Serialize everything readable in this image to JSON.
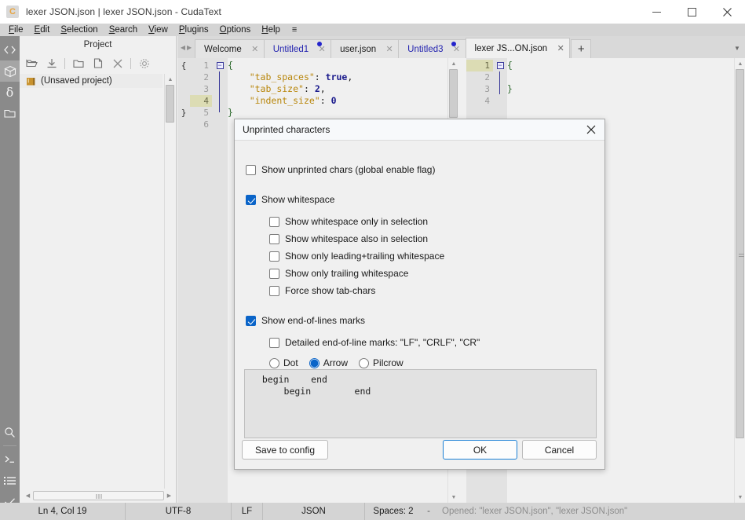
{
  "window": {
    "title": "lexer JSON.json | lexer JSON.json - CudaText",
    "app_icon": "C",
    "minimize_label": "minimize-icon",
    "maximize_label": "maximize-icon",
    "close_label": "close-icon"
  },
  "menubar": {
    "items": [
      {
        "label": "File",
        "accel": "F"
      },
      {
        "label": "Edit",
        "accel": "E"
      },
      {
        "label": "Selection",
        "accel": "S"
      },
      {
        "label": "Search",
        "accel": "S"
      },
      {
        "label": "View",
        "accel": "V"
      },
      {
        "label": "Plugins",
        "accel": "P"
      },
      {
        "label": "Options",
        "accel": "O"
      },
      {
        "label": "Help",
        "accel": "H"
      }
    ],
    "burger": "≡"
  },
  "rail": {
    "items": [
      {
        "name": "code-tree-icon",
        "glyph": "<>"
      },
      {
        "name": "project-box-icon",
        "glyph": "box"
      },
      {
        "name": "delta-icon",
        "glyph": "δ"
      },
      {
        "name": "folder-icon",
        "glyph": "folder"
      }
    ],
    "bottom_items": [
      {
        "name": "search-icon",
        "glyph": "search"
      },
      {
        "name": "console-icon",
        "glyph": ">_"
      },
      {
        "name": "output-list-icon",
        "glyph": "list"
      },
      {
        "name": "validate-check-icon",
        "glyph": "check"
      }
    ]
  },
  "project": {
    "title": "Project",
    "toolbar": [
      {
        "name": "open-project-button",
        "glyph": "open-folder-icon"
      },
      {
        "name": "save-project-button",
        "glyph": "download-icon"
      },
      {
        "name": "add-folder-button",
        "glyph": "folder-icon"
      },
      {
        "name": "add-file-button",
        "glyph": "file-icon"
      },
      {
        "name": "remove-node-button",
        "glyph": "close-icon"
      },
      {
        "name": "project-properties-button",
        "glyph": "gear-icon"
      }
    ],
    "root_node": "(Unsaved project)"
  },
  "tabs": [
    {
      "label": "Welcome",
      "active": false,
      "modified": false
    },
    {
      "label": "Untitled1",
      "active": false,
      "modified": true
    },
    {
      "label": "user.json",
      "active": false,
      "modified": false
    },
    {
      "label": "Untitled3",
      "active": false,
      "modified": true
    },
    {
      "label": "lexer JS...ON.json",
      "active": true,
      "modified": false
    }
  ],
  "tab_controls": {
    "add_tab": "+",
    "dropdown": "▼",
    "nav_left": "◀",
    "nav_right": "▶"
  },
  "editor_left": {
    "gutter_braces": [
      "{",
      "",
      "",
      "",
      "}",
      ""
    ],
    "line_numbers": [
      "1",
      "2",
      "3",
      "4",
      "5",
      "6"
    ],
    "current_line": 4,
    "lines": [
      {
        "segs": [
          {
            "t": "{",
            "c": "c-brace"
          }
        ]
      },
      {
        "segs": [
          {
            "t": "    ",
            "c": "c-punct"
          },
          {
            "t": "\"tab_spaces\"",
            "c": "c-key"
          },
          {
            "t": ": ",
            "c": "c-punct"
          },
          {
            "t": "true",
            "c": "c-bool"
          },
          {
            "t": ",",
            "c": "c-punct"
          }
        ]
      },
      {
        "segs": [
          {
            "t": "    ",
            "c": "c-punct"
          },
          {
            "t": "\"tab_size\"",
            "c": "c-key"
          },
          {
            "t": ": ",
            "c": "c-punct"
          },
          {
            "t": "2",
            "c": "c-num"
          },
          {
            "t": ",",
            "c": "c-punct"
          }
        ]
      },
      {
        "segs": [
          {
            "t": "    ",
            "c": "c-punct"
          },
          {
            "t": "\"indent_size\"",
            "c": "c-key"
          },
          {
            "t": ": ",
            "c": "c-punct"
          },
          {
            "t": "0",
            "c": "c-num"
          }
        ]
      },
      {
        "segs": [
          {
            "t": "}",
            "c": "c-brace"
          }
        ]
      },
      {
        "segs": []
      }
    ]
  },
  "editor_right": {
    "line_numbers": [
      "1",
      "2",
      "3",
      "4"
    ],
    "current_line": 1,
    "lines": [
      {
        "segs": [
          {
            "t": "{",
            "c": "c-brace"
          }
        ]
      },
      {
        "segs": []
      },
      {
        "segs": [
          {
            "t": "}",
            "c": "c-brace"
          }
        ]
      },
      {
        "segs": []
      }
    ]
  },
  "dialog": {
    "title": "Unprinted characters",
    "close_glyph": "✕",
    "checkboxes": [
      {
        "id": "global",
        "label": "Show unprinted chars (global enable flag)",
        "checked": false,
        "indent": 0
      },
      {
        "id": "ws",
        "label": "Show whitespace",
        "checked": true,
        "indent": 0
      },
      {
        "id": "ws_only_sel",
        "label": "Show whitespace only in selection",
        "checked": false,
        "indent": 1
      },
      {
        "id": "ws_also_sel",
        "label": "Show whitespace also in selection",
        "checked": false,
        "indent": 1
      },
      {
        "id": "ws_lead_trail",
        "label": "Show only leading+trailing whitespace",
        "checked": false,
        "indent": 1
      },
      {
        "id": "ws_trail",
        "label": "Show only trailing whitespace",
        "checked": false,
        "indent": 1
      },
      {
        "id": "force_tabs",
        "label": "Force show tab-chars",
        "checked": false,
        "indent": 1
      },
      {
        "id": "eol",
        "label": "Show end-of-lines marks",
        "checked": true,
        "indent": 0
      },
      {
        "id": "eol_detailed",
        "label": "Detailed end-of-line marks: \"LF\", \"CRLF\", \"CR\"",
        "checked": false,
        "indent": 1
      }
    ],
    "radios": [
      {
        "id": "dot",
        "label": "Dot",
        "checked": false
      },
      {
        "id": "arrow",
        "label": "Arrow",
        "checked": true
      },
      {
        "id": "pilcrow",
        "label": "Pilcrow",
        "checked": false
      }
    ],
    "preview_lines": [
      "  begin    end",
      "      begin        end",
      "",
      "",
      ""
    ],
    "buttons": {
      "save_to_config": "Save to config",
      "ok": "OK",
      "cancel": "Cancel"
    }
  },
  "statusbar": {
    "caret": "Ln 4, Col 19",
    "encoding": "UTF-8",
    "line_ending": "LF",
    "lexer": "JSON",
    "indent": "Spaces: 2",
    "separator": "-",
    "message": "Opened: \"lexer JSON.json\", \"lexer JSON.json\""
  },
  "colors": {
    "accent": "#0a64c8",
    "window_bg": "#f0f0f0",
    "menubar_bg": "#d4d4d4",
    "rail_bg": "#8a8a8a",
    "tab_active_bg": "#f0f0f0",
    "modified_tab_fg": "#2424b0",
    "current_line_gutter": "#dcdcb4"
  }
}
